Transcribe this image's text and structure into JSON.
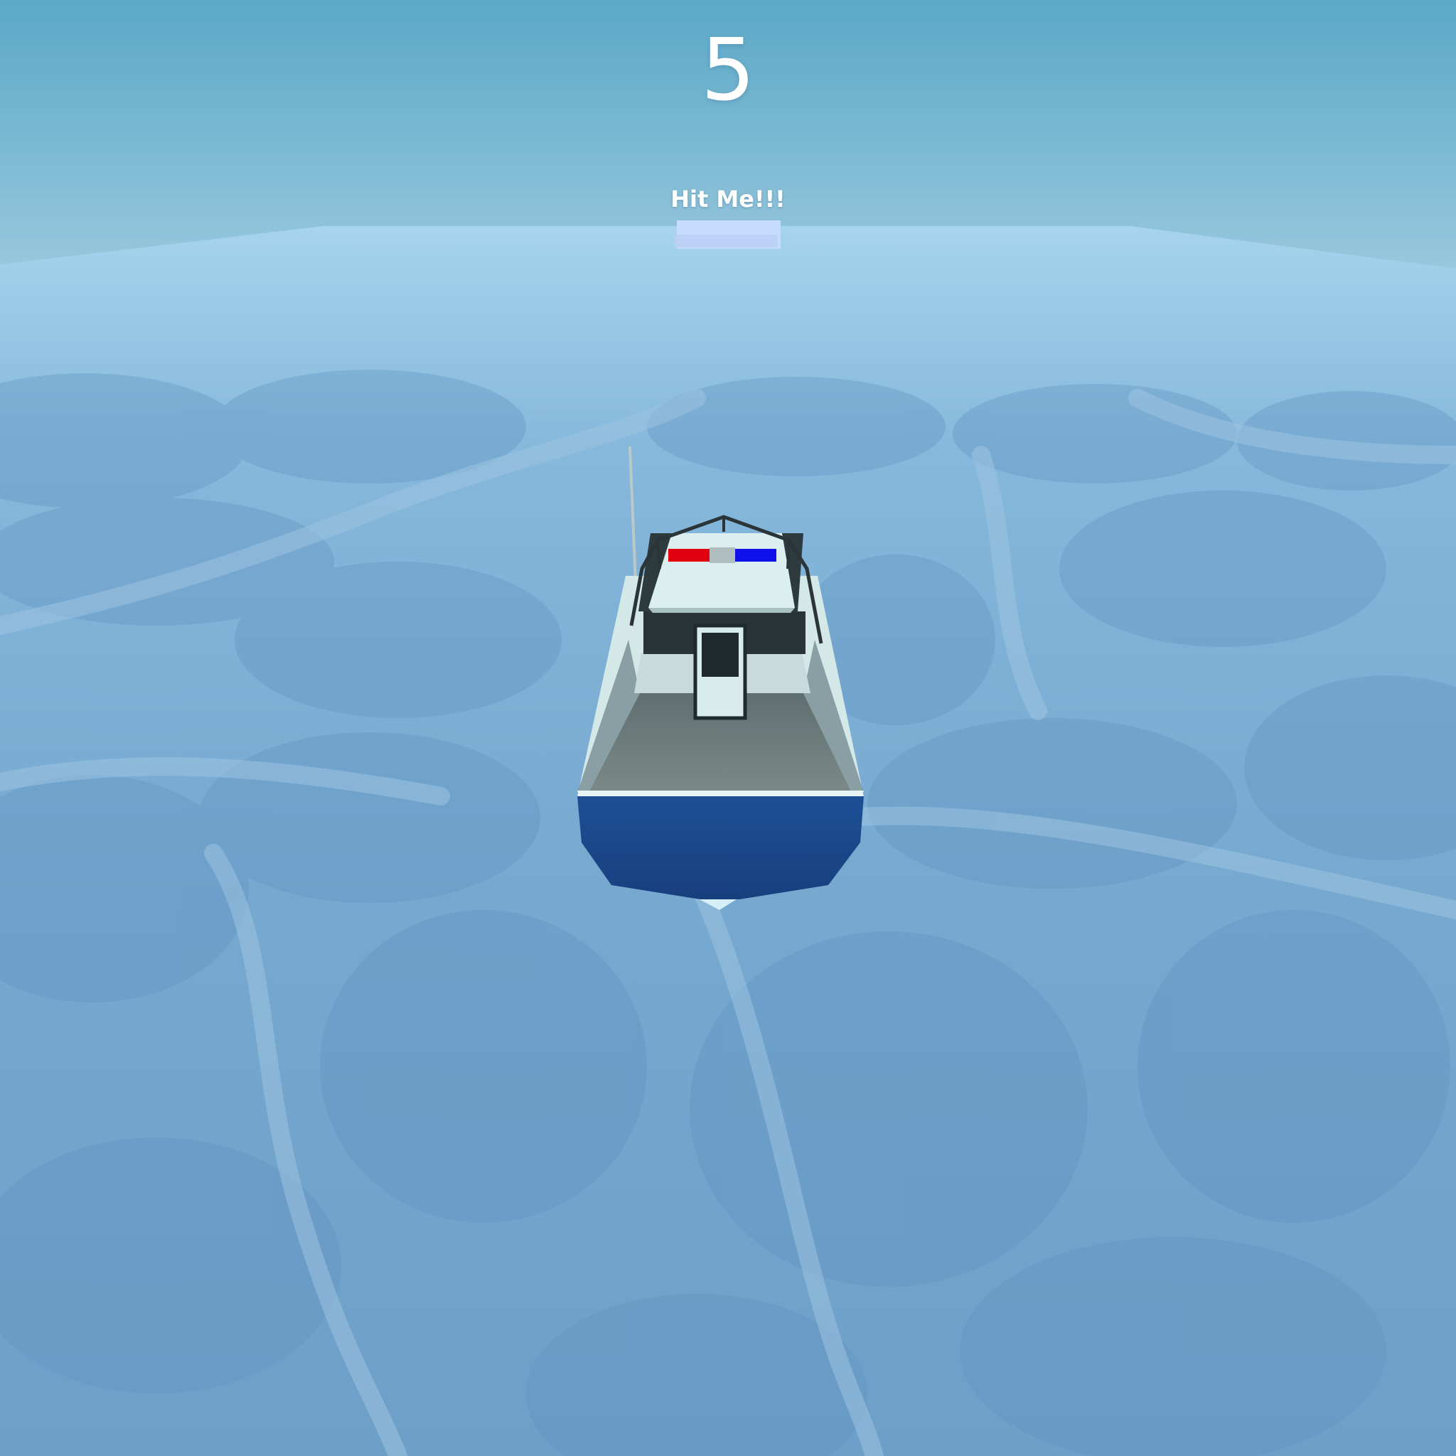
{
  "hud": {
    "score": "5"
  },
  "target": {
    "label": "Hit Me!!!"
  },
  "colors": {
    "sky_top": "#5aa8c8",
    "sky_horizon": "#98c8dc",
    "water": "#6fa3cc",
    "water_pattern": "#8ab4d6",
    "hull": "#1b4b92",
    "deck": "#6f7e7f",
    "cabin": "#d4e8e8",
    "siren_red": "#e00010",
    "siren_blue": "#1010e8",
    "target_block": "#c6dcff"
  },
  "icons": {
    "player": "police-boat-icon",
    "target": "target-block-icon"
  }
}
